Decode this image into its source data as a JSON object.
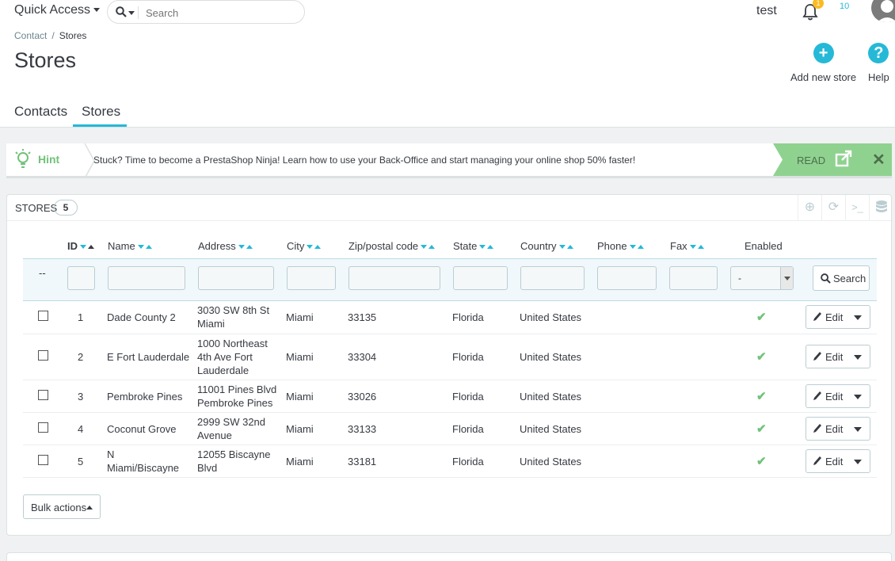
{
  "header": {
    "quick_access": "Quick Access",
    "search_placeholder": "Search",
    "user_name": "test",
    "notifications_count": "1",
    "messages_count": "10",
    "icons": [
      "search-icon",
      "bell-icon",
      "messages-icon",
      "avatar"
    ]
  },
  "breadcrumb": {
    "parent": "Contact",
    "separator": "/",
    "current": "Stores"
  },
  "page": {
    "title": "Stores"
  },
  "toolbar": {
    "add_label": "Add new store",
    "help_label": "Help"
  },
  "tabs": [
    {
      "label": "Contacts",
      "active": false
    },
    {
      "label": "Stores",
      "active": true
    }
  ],
  "hint": {
    "label": "Hint",
    "message": "Stuck? Time to become a PrestaShop Ninja! Learn how to use your Back-Office and start managing your online shop 50% faster!",
    "read_label": "READ",
    "close": "✕"
  },
  "panel": {
    "title": "STORES",
    "count": "5",
    "tools": [
      "add-icon",
      "refresh-icon",
      "sql-icon",
      "database-icon"
    ]
  },
  "columns": {
    "id": "ID",
    "name": "Name",
    "address": "Address",
    "city": "City",
    "zip": "Zip/postal code",
    "state": "State",
    "country": "Country",
    "phone": "Phone",
    "fax": "Fax",
    "enabled": "Enabled"
  },
  "filters": {
    "bulk_placeholder": "--",
    "enabled_value": "-",
    "search_label": "Search"
  },
  "rows": [
    {
      "id": "1",
      "name": "Dade County 2",
      "address": [
        "3030 SW 8th St",
        "Miami"
      ],
      "city": "Miami",
      "zip": "33135",
      "state": "Florida",
      "country": "United States",
      "phone": "",
      "fax": "",
      "enabled": true,
      "action": "Edit"
    },
    {
      "id": "2",
      "name": "E Fort Lauderdale",
      "address": [
        "1000 Northeast",
        "4th Ave Fort",
        "Lauderdale"
      ],
      "city": "Miami",
      "zip": "33304",
      "state": "Florida",
      "country": "United States",
      "phone": "",
      "fax": "",
      "enabled": true,
      "action": "Edit"
    },
    {
      "id": "3",
      "name": "Pembroke Pines",
      "address": [
        "11001 Pines Blvd",
        "Pembroke Pines"
      ],
      "city": "Miami",
      "zip": "33026",
      "state": "Florida",
      "country": "United States",
      "phone": "",
      "fax": "",
      "enabled": true,
      "action": "Edit"
    },
    {
      "id": "4",
      "name": "Coconut Grove",
      "address": [
        "2999 SW 32nd",
        "Avenue"
      ],
      "city": "Miami",
      "zip": "33133",
      "state": "Florida",
      "country": "United States",
      "phone": "",
      "fax": "",
      "enabled": true,
      "action": "Edit"
    },
    {
      "id": "5",
      "name": [
        "N",
        "Miami/Biscayne"
      ],
      "address": [
        "12055 Biscayne",
        "Blvd"
      ],
      "city": "Miami",
      "zip": "33181",
      "state": "Florida",
      "country": "United States",
      "phone": "",
      "fax": "",
      "enabled": true,
      "action": "Edit"
    }
  ],
  "footer": {
    "bulk_actions": "Bulk actions"
  },
  "colors": {
    "accent": "#25b9d7",
    "success": "#72c279",
    "hint_read": "#8fd290",
    "warning": "#fbbb22"
  }
}
